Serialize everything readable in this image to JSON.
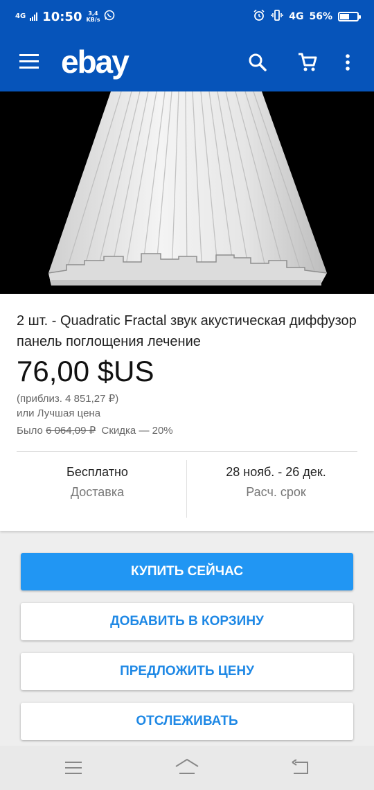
{
  "status_bar": {
    "network": "4G",
    "time": "10:50",
    "speed_value": "3,4",
    "speed_unit": "KB/s",
    "network_right": "4G",
    "battery": "56%",
    "battery_level": 0.56
  },
  "app_bar": {
    "logo": "ebay",
    "menu_icon": "hamburger-menu-icon",
    "search_icon": "search-icon",
    "cart_icon": "shopping-cart-icon",
    "more_icon": "more-vert-icon"
  },
  "listing": {
    "title": "2 шт. - Quadratic Fractal звук акустическая диффузор панель поглощения лечение",
    "price": "76,00 $US",
    "approx_price": "(приблиз. 4 851,27 ₽)",
    "best_offer": "или Лучшая цена",
    "was_label": "Было",
    "was_price": "6 064,09 ₽",
    "discount": "Скидка — 20%",
    "shipping_value": "Бесплатно",
    "shipping_label": "Доставка",
    "delivery_value": "28 нояб. - 26 дек.",
    "delivery_label": "Расч. срок"
  },
  "actions": {
    "buy_now": "КУПИТЬ СЕЙЧАС",
    "add_to_cart": "ДОБАВИТЬ В КОРЗИНУ",
    "make_offer": "ПРЕДЛОЖИТЬ ЦЕНУ",
    "watch": "ОТСЛЕЖИВАТЬ"
  },
  "colors": {
    "brand_blue": "#0654ba",
    "button_blue": "#2196f3",
    "link_blue": "#1e88e5"
  }
}
